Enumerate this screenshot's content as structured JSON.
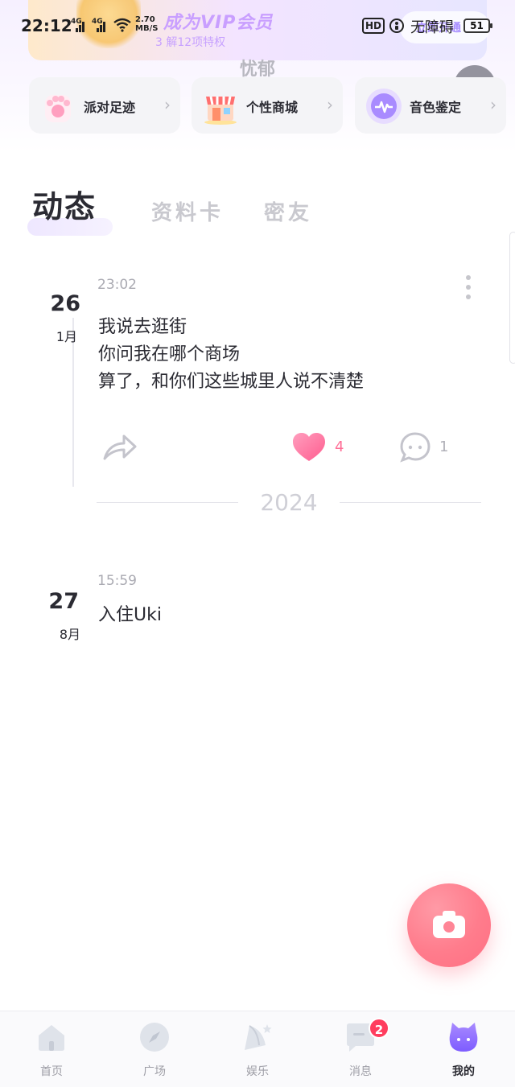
{
  "status_bar": {
    "time": "22:12",
    "network_1": "4G",
    "network_2": "4G",
    "speed_value": "2.70",
    "speed_unit": "MB/S",
    "hd": "HD",
    "accessibility": "无障碍",
    "battery": "51"
  },
  "vip": {
    "title": "成为VIP会员",
    "subtitle": "3 解12项特权",
    "button": "立即开通"
  },
  "profile": {
    "nickname": "忧郁"
  },
  "quick_cards": [
    {
      "label": "派对足迹"
    },
    {
      "label": "个性商城"
    },
    {
      "label": "音色鉴定"
    }
  ],
  "tabs": [
    {
      "label": "动态",
      "active": true
    },
    {
      "label": "资料卡",
      "active": false
    },
    {
      "label": "密友",
      "active": false
    }
  ],
  "posts": [
    {
      "day": "26",
      "month": "1月",
      "time": "23:02",
      "text": "我说去逛街\n你问我在哪个商场\n算了，和你们这些城里人说不清楚",
      "likes": "4",
      "comments": "1"
    },
    {
      "day": "27",
      "month": "8月",
      "time": "15:59",
      "text": "入住Uki"
    }
  ],
  "year_separator": "2024",
  "bottom_nav": [
    {
      "label": "首页",
      "icon": "home-icon"
    },
    {
      "label": "广场",
      "icon": "compass-icon"
    },
    {
      "label": "娱乐",
      "icon": "party-icon"
    },
    {
      "label": "消息",
      "icon": "message-icon",
      "badge": "2"
    },
    {
      "label": "我的",
      "icon": "cat-avatar-icon",
      "active": true
    }
  ],
  "colors": {
    "accent_pink": "#ff6f97",
    "fab": "#ff7c8c",
    "badge": "#ff3d5e",
    "vip_purple": "#c79bff"
  }
}
